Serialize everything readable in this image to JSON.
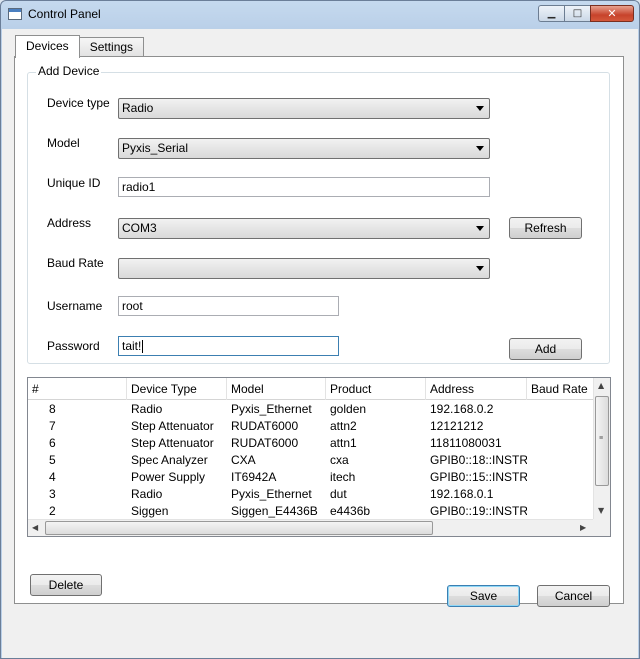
{
  "window": {
    "title": "Control Panel",
    "close_glyph": "✕",
    "min_glyph": "▁",
    "max_glyph": "□"
  },
  "tabs": [
    {
      "label": "Devices",
      "active": true
    },
    {
      "label": "Settings",
      "active": false
    }
  ],
  "add_device": {
    "group_title": "Add Device",
    "device_type": {
      "label": "Device type",
      "value": "Radio"
    },
    "model": {
      "label": "Model",
      "value": "Pyxis_Serial"
    },
    "unique_id": {
      "label": "Unique ID",
      "value": "radio1"
    },
    "address": {
      "label": "Address",
      "value": "COM3"
    },
    "baud_rate": {
      "label": "Baud Rate",
      "value": ""
    },
    "username": {
      "label": "Username",
      "value": "root"
    },
    "password": {
      "label": "Password",
      "value": "tait!"
    },
    "refresh_label": "Refresh",
    "add_label": "Add"
  },
  "table": {
    "columns": [
      "#",
      "Device Type",
      "Model",
      "Product",
      "Address",
      "Baud Rate"
    ],
    "rows": [
      [
        "8",
        "Radio",
        "Pyxis_Ethernet",
        "golden",
        "192.168.0.2",
        ""
      ],
      [
        "7",
        "Step Attenuator",
        "RUDAT6000",
        "attn2",
        "12121212",
        ""
      ],
      [
        "6",
        "Step Attenuator",
        "RUDAT6000",
        "attn1",
        "11811080031",
        ""
      ],
      [
        "5",
        "Spec Analyzer",
        "CXA",
        "cxa",
        "GPIB0::18::INSTR",
        ""
      ],
      [
        "4",
        "Power Supply",
        "IT6942A",
        "itech",
        "GPIB0::15::INSTR",
        ""
      ],
      [
        "3",
        "Radio",
        "Pyxis_Ethernet",
        "dut",
        "192.168.0.1",
        ""
      ],
      [
        "2",
        "Siggen",
        "Siggen_E4436B",
        "e4436b",
        "GPIB0::19::INSTR",
        ""
      ]
    ]
  },
  "delete_label": "Delete",
  "save_label": "Save",
  "cancel_label": "Cancel"
}
